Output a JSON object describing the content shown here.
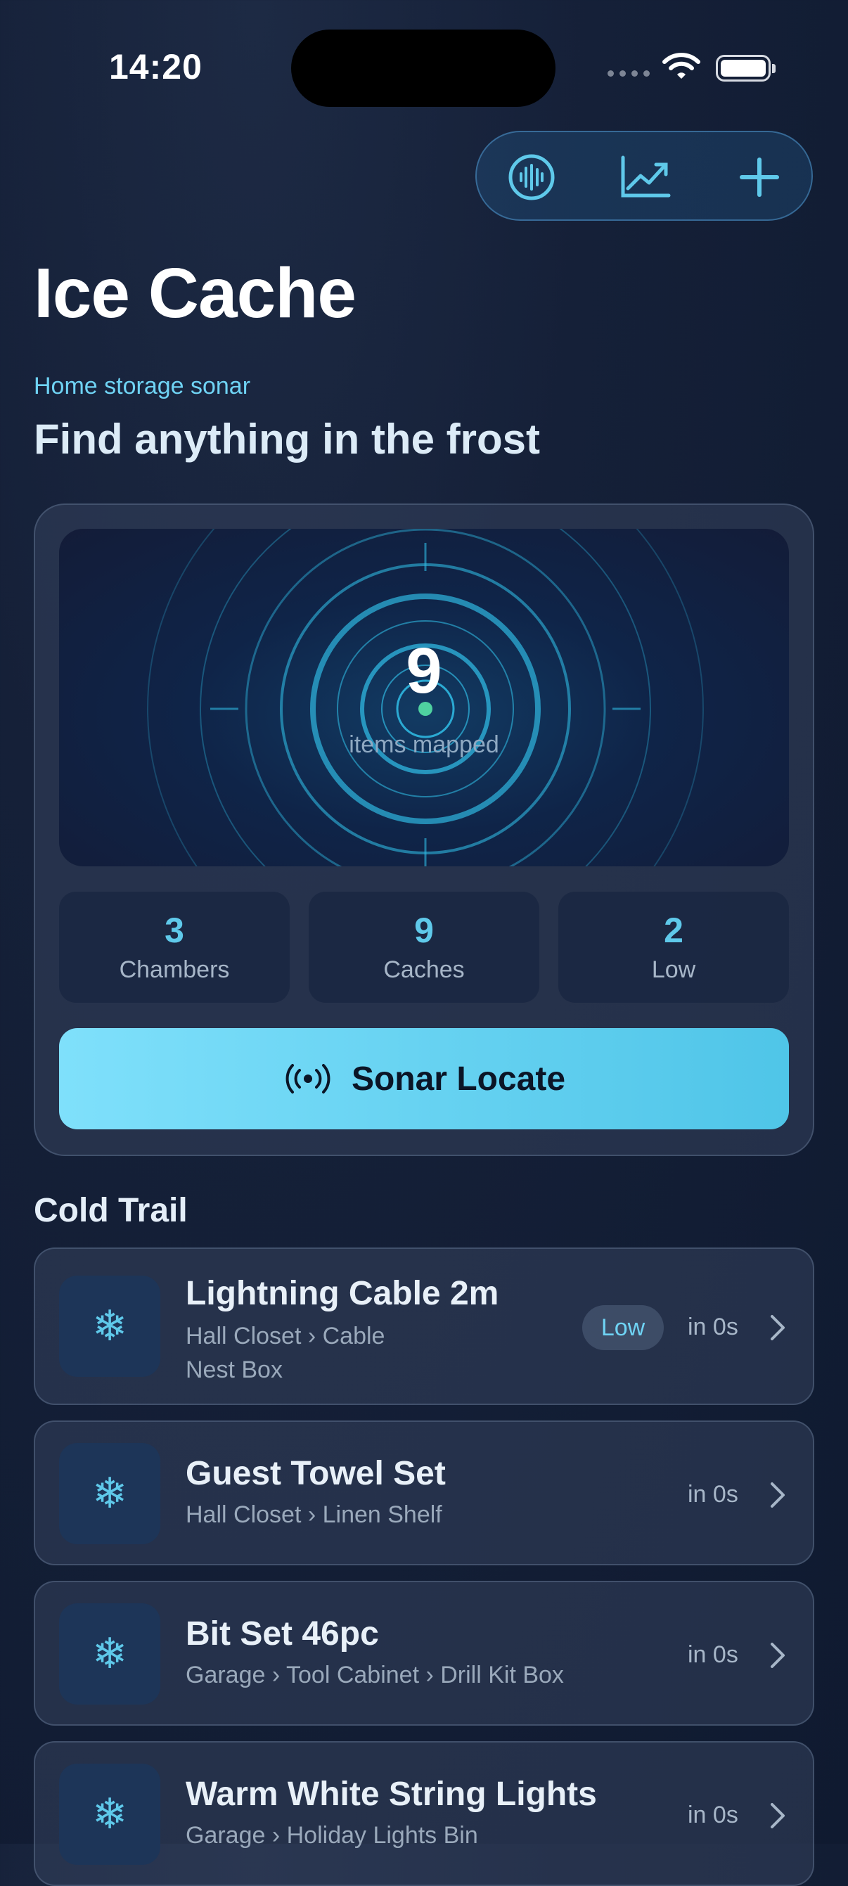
{
  "status_bar": {
    "time": "14:20"
  },
  "toolbar": {
    "icons": [
      "waveform-icon",
      "chart-icon",
      "plus-icon"
    ]
  },
  "header": {
    "app_title": "Ice Cache",
    "eyebrow": "Home storage sonar",
    "subtitle": "Find anything in the frost"
  },
  "sonar": {
    "count": "9",
    "label": "items mapped"
  },
  "stats": [
    {
      "value": "3",
      "label": "Chambers"
    },
    {
      "value": "9",
      "label": "Caches"
    },
    {
      "value": "2",
      "label": "Low"
    }
  ],
  "sonar_button": {
    "label": "Sonar Locate"
  },
  "cold_trail": {
    "title": "Cold Trail",
    "items": [
      {
        "name": "Lightning Cable 2m",
        "path_line1": "Hall Closet › Cable",
        "path_line2": "Nest Box",
        "badge": "Low",
        "due": "in 0s"
      },
      {
        "name": "Guest Towel Set",
        "path_line1": "Hall Closet › Linen Shelf",
        "due": "in 0s"
      },
      {
        "name": "Bit Set 46pc",
        "path_line1": "Garage › Tool Cabinet › Drill Kit Box",
        "due": "in 0s"
      },
      {
        "name": "Warm White String Lights",
        "path_line1": "Garage › Holiday Lights Bin",
        "due": "in 0s"
      }
    ]
  },
  "colors": {
    "accent": "#5fc9ea",
    "button": "#6fd9f7"
  }
}
